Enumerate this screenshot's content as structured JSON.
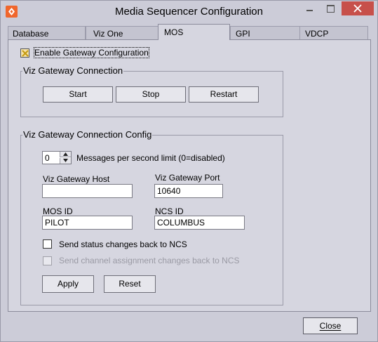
{
  "window": {
    "title": "Media Sequencer Configuration",
    "close_label": "Close"
  },
  "tabs": [
    {
      "label": "Database"
    },
    {
      "label": "Viz One"
    },
    {
      "label": "MOS"
    },
    {
      "label": "GPI"
    },
    {
      "label": "VDCP"
    }
  ],
  "active_tab": "MOS",
  "mos": {
    "enable_gateway_label": "Enable Gateway Configuration",
    "enable_gateway_checked": true,
    "connection": {
      "title": "Viz Gateway Connection",
      "start_label": "Start",
      "stop_label": "Stop",
      "restart_label": "Restart"
    },
    "config": {
      "title": "Viz Gateway Connection Config",
      "rate_value": "0",
      "rate_label": "Messages per second limit (0=disabled)",
      "host_label": "Viz Gateway Host",
      "host_value": "",
      "port_label": "Viz Gateway Port",
      "port_value": "10640",
      "mos_id_label": "MOS ID",
      "mos_id_value": "PILOT",
      "ncs_id_label": "NCS ID",
      "ncs_id_value": "COLUMBUS",
      "send_status_label": "Send status changes back to NCS",
      "send_status_checked": false,
      "send_channel_label": "Send channel assignment changes back to NCS",
      "send_channel_enabled": false,
      "apply_label": "Apply",
      "reset_label": "Reset"
    }
  },
  "colors": {
    "window_bg": "#ccccd8",
    "panel_bg": "#d6d6e0",
    "close_button": "#c7504a",
    "app_icon": "#f0662c"
  }
}
